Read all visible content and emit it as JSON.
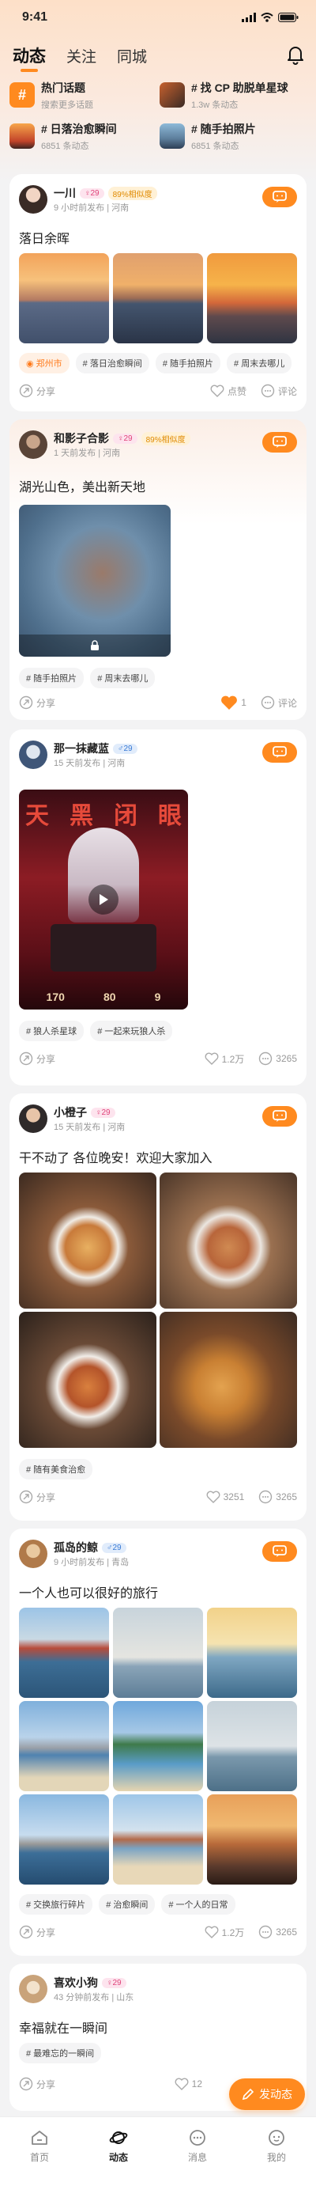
{
  "status": {
    "time": "9:41"
  },
  "nav": {
    "tabs": [
      "动态",
      "关注",
      "同城"
    ]
  },
  "topics": [
    {
      "name": "热门话题",
      "sub": "搜索更多话题"
    },
    {
      "name": "# 找 CP 助脱单星球",
      "sub": "1.3w 条动态"
    },
    {
      "name": "# 日落治愈瞬间",
      "sub": "6851 条动态"
    },
    {
      "name": "# 随手拍照片",
      "sub": "6851 条动态"
    }
  ],
  "posts": [
    {
      "name": "一川",
      "age": "29",
      "level": "89%相似度",
      "meta": "9 小时前发布 | 河南",
      "text": "落日余晖",
      "chips": [
        "郑州市",
        "# 落日治愈瞬间",
        "# 随手拍照片",
        "# 周末去哪儿"
      ],
      "share": "分享",
      "like": "点赞",
      "comment": "评论"
    },
    {
      "name": "和影子合影",
      "age": "29",
      "level": "89%相似度",
      "meta": "1 天前发布 | 河南",
      "text": "湖光山色，美出新天地",
      "chips": [
        "# 随手拍照片",
        "# 周末去哪儿"
      ],
      "share": "分享",
      "like": "1",
      "comment": "评论"
    },
    {
      "name": "那一抹藏蓝",
      "age": "29",
      "meta": "15 天前发布 | 河南",
      "chips": [
        "# 狼人杀星球",
        "# 一起来玩狼人杀"
      ],
      "share": "分享",
      "like": "1.2万",
      "comment": "3265",
      "cover_lines": [
        "天",
        "黑",
        "闭",
        "眼"
      ],
      "cover_nums": [
        "170",
        "80",
        "9"
      ]
    },
    {
      "name": "小橙子",
      "age": "29",
      "meta": "15 天前发布 | 河南",
      "text": "干不动了 各位晚安！欢迎大家加入",
      "chips": [
        "# 随有美食治愈"
      ],
      "share": "分享",
      "like": "3251",
      "comment": "3265"
    },
    {
      "name": "孤岛的鲸",
      "age": "29",
      "meta": "9 小时前发布 | 青岛",
      "text": "一个人也可以很好的旅行",
      "chips": [
        "# 交换旅行碎片",
        "# 治愈瞬间",
        "# 一个人的日常"
      ],
      "share": "分享",
      "like": "1.2万",
      "comment": "3265"
    },
    {
      "name": "喜欢小狗",
      "age": "29",
      "meta": "43 分钟前发布 | 山东",
      "text": "幸福就在一瞬间",
      "chips": [
        "# 最难忘的一瞬间"
      ],
      "share": "分享",
      "like": "12",
      "comment": ""
    }
  ],
  "fab": {
    "label": "发动态"
  },
  "tabbar": [
    "首页",
    "动态",
    "消息",
    "我的"
  ],
  "colors": {
    "accent": "#ff8a1f",
    "female": "#e0457b",
    "male": "#3a7bd5"
  }
}
